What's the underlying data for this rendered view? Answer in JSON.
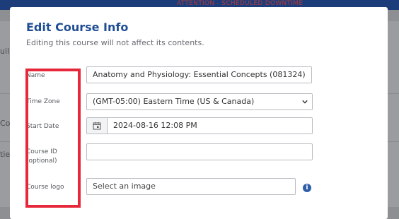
{
  "backdrop": {
    "banner_text": "ATTENTION - SCHEDULED DOWNTIME",
    "fragments": [
      "uil",
      "Con",
      "ties"
    ]
  },
  "modal": {
    "title": "Edit Course Info",
    "subtitle": "Editing this course will not affect its contents.",
    "fields": {
      "name": {
        "label": "Name",
        "value": "Anatomy and Physiology: Essential Concepts (081324)"
      },
      "time_zone": {
        "label": "Time Zone",
        "value": "(GMT-05:00) Eastern Time (US & Canada)"
      },
      "start_date": {
        "label": "Start Date",
        "value": "2024-08-16 12:08 PM"
      },
      "course_id": {
        "label": "Course ID",
        "label_note": "(optional)",
        "value": ""
      },
      "course_logo": {
        "label": "Course logo",
        "placeholder": "Select an image"
      }
    }
  },
  "colors": {
    "title": "#1f4e94",
    "highlight": "#e6283a",
    "info": "#2f5ea8"
  },
  "icons": {
    "date": "calendar-icon",
    "select": "chevron-down-icon",
    "info": "info-icon"
  }
}
